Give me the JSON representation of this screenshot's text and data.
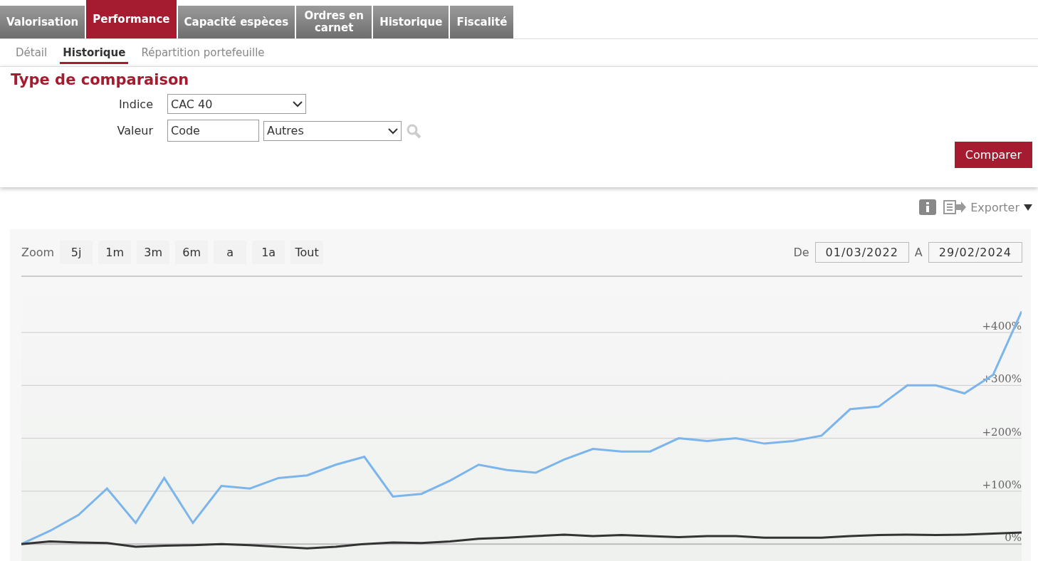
{
  "tabs": [
    {
      "label": "Valorisation",
      "selected": false
    },
    {
      "label": "Performance",
      "selected": true
    },
    {
      "label": "Capacité espèces",
      "selected": false
    },
    {
      "label": "Ordres en carnet",
      "selected": false
    },
    {
      "label": "Historique",
      "selected": false
    },
    {
      "label": "Fiscalité",
      "selected": false
    }
  ],
  "subtabs": [
    {
      "label": "Détail",
      "selected": false
    },
    {
      "label": "Historique",
      "selected": true
    },
    {
      "label": "Répartition portefeuille",
      "selected": false
    }
  ],
  "comparison": {
    "title": "Type de comparaison",
    "index_label": "Indice",
    "index_value": "CAC 40",
    "value_label": "Valeur",
    "code_placeholder": "Code",
    "category_value": "Autres",
    "button": "Comparer"
  },
  "export": {
    "label": "Exporter"
  },
  "chart": {
    "zoom_label": "Zoom",
    "zoom_buttons": [
      "5j",
      "1m",
      "3m",
      "6m",
      "a",
      "1a",
      "Tout"
    ],
    "from_label": "De",
    "from_value": "01/03/2022",
    "to_label": "A",
    "to_value": "29/02/2024",
    "chart_data": {
      "type": "line",
      "grid": true,
      "ylim": [
        -36,
        505
      ],
      "yticks": [
        {
          "value": 0,
          "label": "0%"
        },
        {
          "value": 100,
          "label": "+100%"
        },
        {
          "value": 200,
          "label": "+200%"
        },
        {
          "value": 300,
          "label": "+300%"
        },
        {
          "value": 400,
          "label": "+400%"
        }
      ],
      "series": [
        {
          "color": "#7cb5ec",
          "values": [
            0,
            25,
            55,
            105,
            40,
            125,
            40,
            110,
            105,
            125,
            130,
            150,
            165,
            90,
            95,
            120,
            150,
            140,
            135,
            160,
            180,
            175,
            175,
            200,
            195,
            200,
            190,
            195,
            205,
            255,
            260,
            300,
            300,
            285,
            320,
            440
          ]
        },
        {
          "color": "#333333",
          "values": [
            0,
            5,
            3,
            2,
            -5,
            -3,
            -2,
            0,
            -2,
            -5,
            -8,
            -5,
            0,
            3,
            2,
            5,
            10,
            12,
            15,
            18,
            15,
            17,
            15,
            13,
            15,
            15,
            12,
            12,
            12,
            15,
            17,
            18,
            17,
            18,
            20,
            22
          ]
        }
      ]
    }
  }
}
